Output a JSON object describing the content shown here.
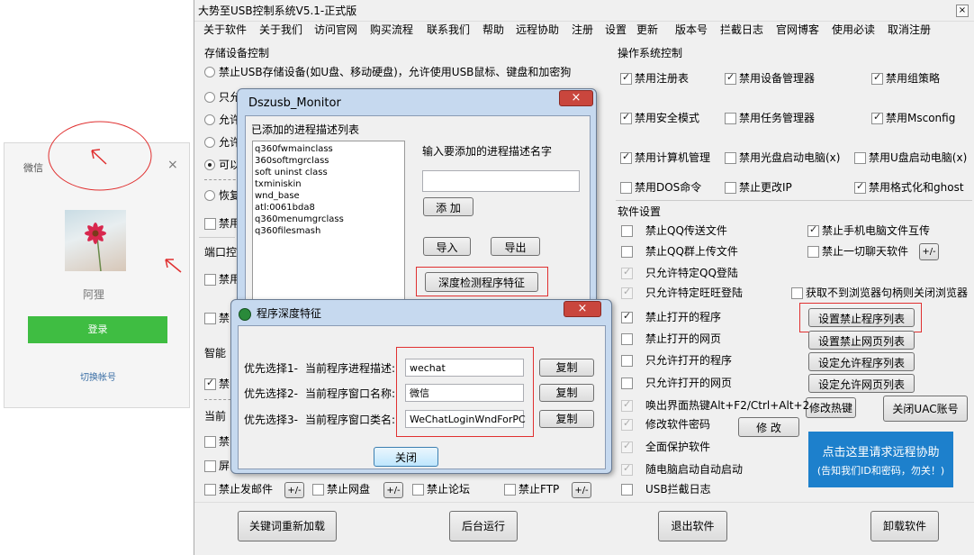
{
  "wechat": {
    "title": "微信",
    "close": "×",
    "name": "阿狸",
    "login": "登录",
    "switch": "切换帐号"
  },
  "main": {
    "title": "大势至USB控制系统V5.1-正式版",
    "menu": [
      "关于软件",
      "关于我们",
      "访问官网",
      "购买流程",
      "联系我们",
      "帮助",
      "远程协助",
      "注册",
      "设置",
      "更新",
      "版本号",
      "拦截日志",
      "官网博客",
      "使用必读",
      "取消注册"
    ],
    "storage": {
      "title": "存储设备控制",
      "opt1": "禁止USB存储设备(如U盘、移动硬盘)，允许使用USB鼠标、键盘和加密狗",
      "opt2": "只允",
      "opt3": "允许",
      "opt4": "允许",
      "opt5": "可以",
      "opt6": "恢复"
    },
    "left_partial": {
      "disable_prefix": "禁用",
      "port_title": "端口控制",
      "port_item1": "禁用",
      "port_item2": "禁",
      "smart_title": "智能",
      "smart_item": "禁",
      "current_title": "当前",
      "row3": "禁",
      "row4": "屏"
    },
    "bottom_row": {
      "mail": "禁止发邮件",
      "plusminus": "+/-",
      "netdisk": "禁止网盘",
      "forum": "禁止论坛",
      "ftp": "禁止FTP"
    },
    "os": {
      "title": "操作系统控制",
      "items": [
        "禁用注册表",
        "禁用设备管理器",
        "禁用组策略",
        "禁用安全模式",
        "禁用任务管理器",
        "禁用Msconfig",
        "禁用计算机管理",
        "禁用光盘启动电脑(x)",
        "禁用U盘启动电脑(x)",
        "禁用DOS命令",
        "禁止更改IP",
        "禁用格式化和ghost"
      ]
    },
    "soft": {
      "title": "软件设置",
      "items": [
        "禁止QQ传送文件",
        "禁止QQ群上传文件",
        "只允许特定QQ登陆",
        "只允许特定旺旺登陆",
        "禁止打开的程序",
        "禁止打开的网页",
        "只允许打开的程序",
        "只允许打开的网页",
        "唤出界面热键Alt+F2/Ctrl+Alt+2",
        "修改软件密码",
        "全面保护软件",
        "随电脑启动自动启动",
        "USB拦截日志"
      ],
      "right_items": [
        "禁止手机电脑文件互传",
        "禁止一切聊天软件",
        "获取不到浏览器句柄则关闭浏览器"
      ],
      "buttons": {
        "plusminus": "+/-",
        "set_forbid_prog": "设置禁止程序列表",
        "set_forbid_web": "设置禁止网页列表",
        "set_allow_prog": "设定允许程序列表",
        "set_allow_web": "设定允许网页列表",
        "modify_hotkey": "修改热键",
        "close_uac": "关闭UAC账号",
        "modify": "修 改"
      },
      "remote": {
        "line1": "点击这里请求远程协助",
        "line2": "(告知我们ID和密码，勿关！)"
      }
    },
    "footer": {
      "reload": "关键词重新加载",
      "background": "后台运行",
      "exit": "退出软件",
      "uninstall": "卸载软件"
    },
    "close_x": "×"
  },
  "monitor": {
    "title": "Dszusb_Monitor",
    "list_label": "已添加的进程描述列表",
    "list": [
      "q360fwmainclass",
      "360softmgrclass",
      "soft uninst class",
      "txminiskin",
      "wnd_base",
      "atl:0061bda8",
      "q360menumgrclass",
      "q360filesmash"
    ],
    "input_label": "输入要添加的进程描述名字",
    "add": "添 加",
    "import": "导入",
    "export": "导出",
    "deep": "深度检测程序特征",
    "close": "×"
  },
  "feature": {
    "title": "程序深度特征",
    "close": "×",
    "rows": [
      {
        "pri": "优先选择1-",
        "label": "当前程序进程描述:",
        "value": "wechat",
        "copy": "复制"
      },
      {
        "pri": "优先选择2-",
        "label": "当前程序窗口名称:",
        "value": "微信",
        "copy": "复制"
      },
      {
        "pri": "优先选择3-",
        "label": "当前程序窗口类名:",
        "value": "WeChatLoginWndForPC",
        "copy": "复制"
      }
    ],
    "close_btn": "关闭"
  },
  "colors": {
    "accent_green": "#3fbd42",
    "annotation_red": "#e03030",
    "remote_blue": "#1d80cc"
  }
}
